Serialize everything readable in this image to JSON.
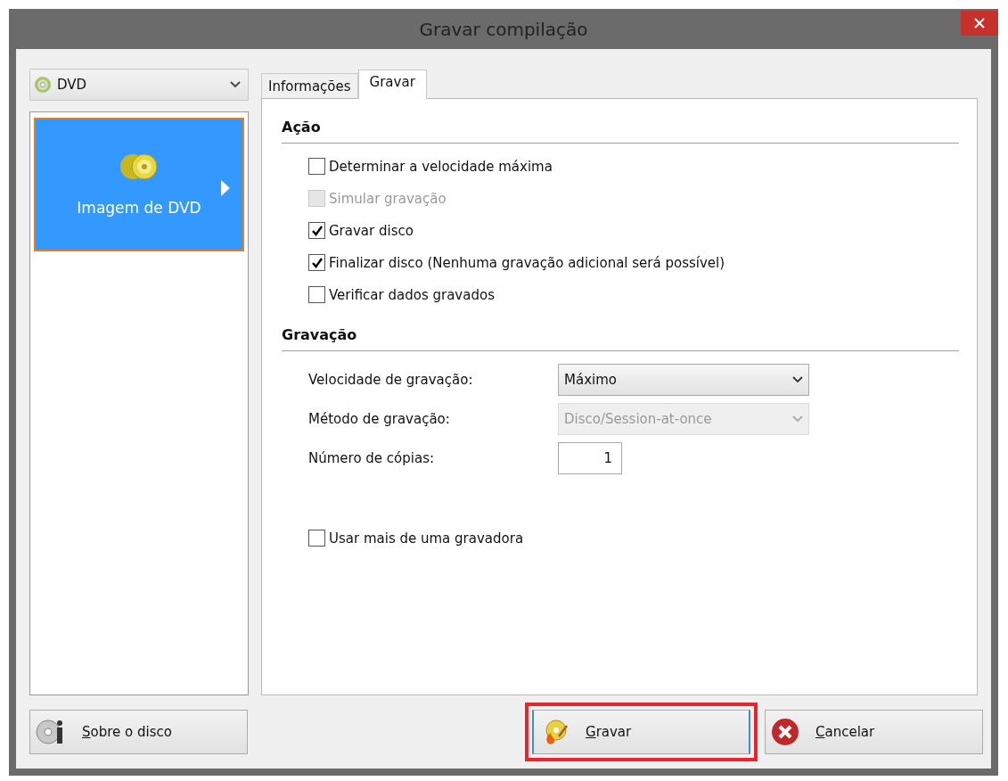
{
  "window": {
    "title": "Gravar compilação"
  },
  "disc_type": {
    "value": "DVD"
  },
  "sidebar": {
    "items": [
      {
        "label": "Imagem de DVD",
        "selected": true
      }
    ]
  },
  "tabs": [
    {
      "label": "Informações",
      "selected": false
    },
    {
      "label": "Gravar",
      "selected": true
    }
  ],
  "sections": [
    {
      "title": "Ação",
      "options": [
        {
          "label": "Determinar a velocidade máxima",
          "checked": false,
          "disabled": false
        },
        {
          "label": "Simular gravação",
          "checked": false,
          "disabled": true
        },
        {
          "label": "Gravar disco",
          "checked": true,
          "disabled": false
        },
        {
          "label": "Finalizar disco (Nenhuma gravação adicional será possível)",
          "checked": true,
          "disabled": false
        },
        {
          "label": "Verificar dados gravados",
          "checked": false,
          "disabled": false
        }
      ]
    },
    {
      "title": "Gravação",
      "fields": [
        {
          "kind": "select",
          "label": "Velocidade de gravação:",
          "value": "Máximo",
          "disabled": false
        },
        {
          "kind": "select",
          "label": "Método de gravação:",
          "value": "Disco/Session-at-once",
          "disabled": true
        },
        {
          "kind": "number",
          "label": "Número de cópias:",
          "value": "1",
          "disabled": false
        }
      ]
    }
  ],
  "extra_option": {
    "label": "Usar mais de uma gravadora",
    "checked": false
  },
  "buttons": [
    {
      "kind": "about",
      "label": "Sobre o disco",
      "highlighted": false
    },
    {
      "kind": "burn",
      "label": "Gravar",
      "highlighted": true
    },
    {
      "kind": "cancel",
      "label": "Cancelar",
      "highlighted": false
    }
  ]
}
